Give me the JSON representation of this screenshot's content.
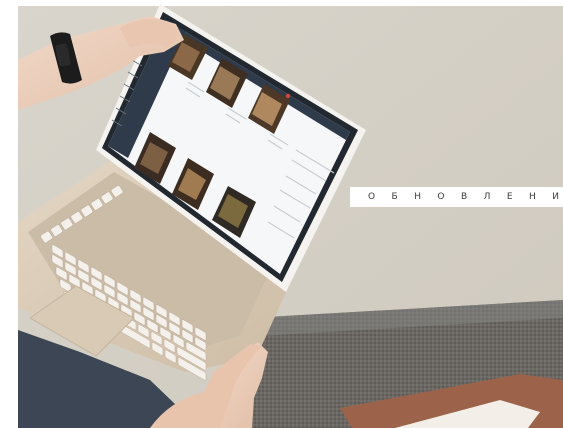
{
  "caption": {
    "letters": [
      "О",
      "Б",
      "Н",
      "О",
      "В",
      "Л",
      "Е",
      "Н",
      "И"
    ]
  },
  "colors": {
    "wall": "#d6d1c7",
    "laptop": "#d8c9b6",
    "screen_sidebar": "#2f3a4a",
    "sofa": "#6d6a66",
    "folder": "#a0684e"
  },
  "icons": [
    "laptop-photo",
    "hands-photo",
    "fitness-band-photo"
  ]
}
